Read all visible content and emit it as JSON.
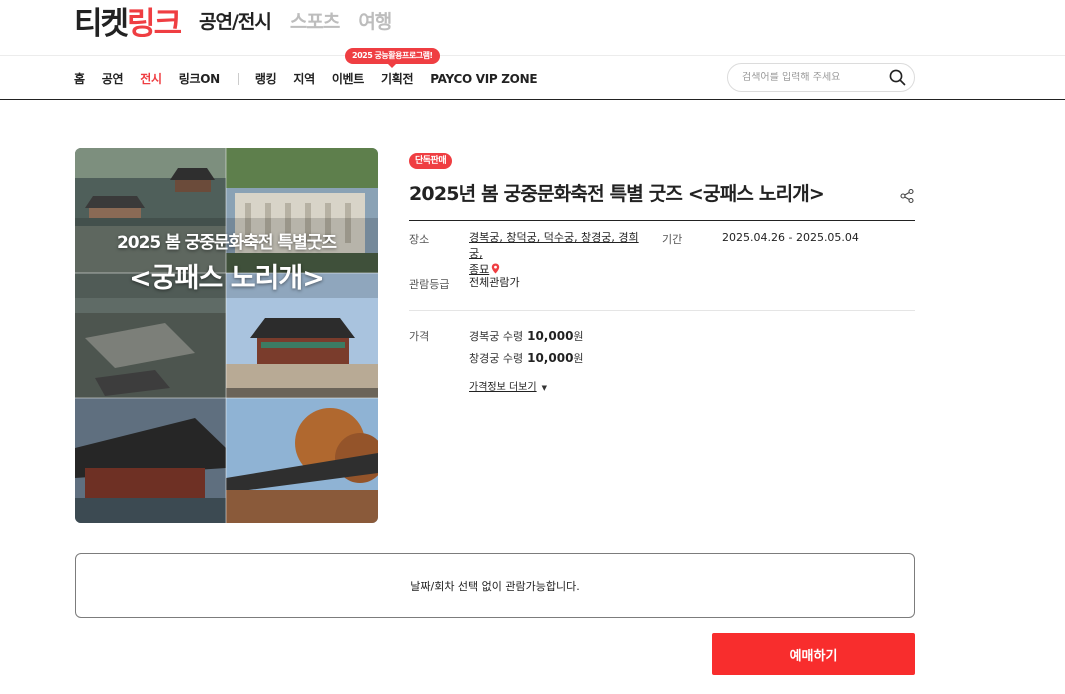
{
  "header": {
    "logo_prefix": "티켓",
    "logo_accent": "링크",
    "categories": [
      "공연/전시",
      "스포츠",
      "여행"
    ]
  },
  "nav": {
    "items_left": [
      "홈",
      "공연",
      "전시",
      "링크ON"
    ],
    "items_right": [
      "랭킹",
      "지역",
      "이벤트",
      "기획전",
      "PAYCO VIP ZONE"
    ],
    "event_badge": "2025 궁능활용프로그램!",
    "active_item": "전시"
  },
  "search": {
    "placeholder": "검색어를 입력해 주세요"
  },
  "poster": {
    "line1": "2025 봄 궁중문화축전 특별굿즈",
    "line2": "<궁패스 노리개>"
  },
  "product": {
    "badge": "단독판매",
    "title": "2025년 봄 궁중문화축전 특별 굿즈 <궁패스 노리개>",
    "venue_label": "장소",
    "venue_line1": "경복궁, 창덕궁, 덕수궁, 창경궁, 경희궁,",
    "venue_line2": "종묘",
    "period_label": "기간",
    "period": "2025.04.26 - 2025.05.04",
    "rating_label": "관람등급",
    "rating": "전체관람가",
    "price_label": "가격",
    "prices": [
      {
        "name": "경복궁 수령",
        "amount": "10,000",
        "unit": "원"
      },
      {
        "name": "창경궁 수령",
        "amount": "10,000",
        "unit": "원"
      }
    ],
    "more_price": "가격정보 더보기"
  },
  "notice": "날짜/회차 선택 없이 관람가능합니다.",
  "book_button": "예매하기",
  "colors": {
    "accent": "#ef3e42",
    "button": "#f82d2d"
  }
}
